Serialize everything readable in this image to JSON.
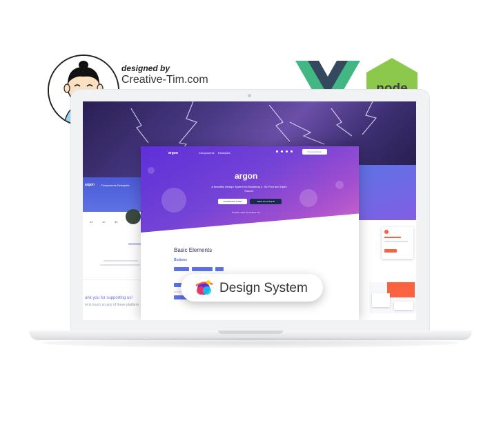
{
  "designer": {
    "designed_by": "designed by",
    "name": "Creative-Tim.com",
    "avatar_icon": "cartoon-avatar-icon"
  },
  "logos": [
    {
      "name": "vue-logo",
      "colors": [
        "#41b883",
        "#35495e"
      ]
    },
    {
      "name": "node-logo",
      "text": "node",
      "color": "#8cc84b"
    }
  ],
  "screen": {
    "center": {
      "brand": "argon",
      "nav": [
        "Components",
        "Examples"
      ],
      "nav_button": "Download Now",
      "hero_text": "A beautiful Design System for Bootstrap 4. It's Free and Open Source.",
      "primary_button": "DOWNLOAD HTML",
      "secondary_button": "VIEW ON GITHUB",
      "powered": "Proudly coded by Creative Tim",
      "section_title": "Basic Elements",
      "buttons_label": "Buttons"
    },
    "left": {
      "nav": [
        "Components",
        "Examples"
      ],
      "stats": [
        "22",
        "10",
        "89"
      ],
      "thanks": "ank you for supporting us!",
      "thanks_sub": "et in touch on any of these platform"
    }
  },
  "badge": {
    "label": "Design System",
    "icon": "argon-planet-icon"
  },
  "colors": {
    "primary": "#5e72e4",
    "purple_hero": "#7443d6",
    "node_green": "#8cc84b"
  }
}
